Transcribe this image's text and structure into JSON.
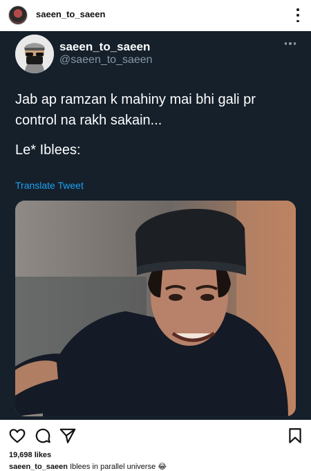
{
  "post_header": {
    "username": "saeen_to_saeen"
  },
  "tweet": {
    "display_name": "saeen_to_saeen",
    "handle": "@saeen_to_saeen",
    "text_line1": "Jab ap ramzan k mahiny mai bhi gali pr",
    "text_line2": "control na rakh sakain...",
    "text_line3": "Le* Iblees:",
    "translate_label": "Translate Tweet"
  },
  "actions": {
    "like_icon": "heart-icon",
    "comment_icon": "comment-icon",
    "share_icon": "paper-plane-icon",
    "save_icon": "bookmark-icon"
  },
  "stats": {
    "likes": "19,698 likes"
  },
  "caption": {
    "username": "saeen_to_saeen",
    "text": "Iblees in parallel universe 😂"
  },
  "colors": {
    "tweet_bg": "#15202b",
    "tweet_link": "#1da1f2",
    "tweet_secondary": "#8899a6"
  }
}
